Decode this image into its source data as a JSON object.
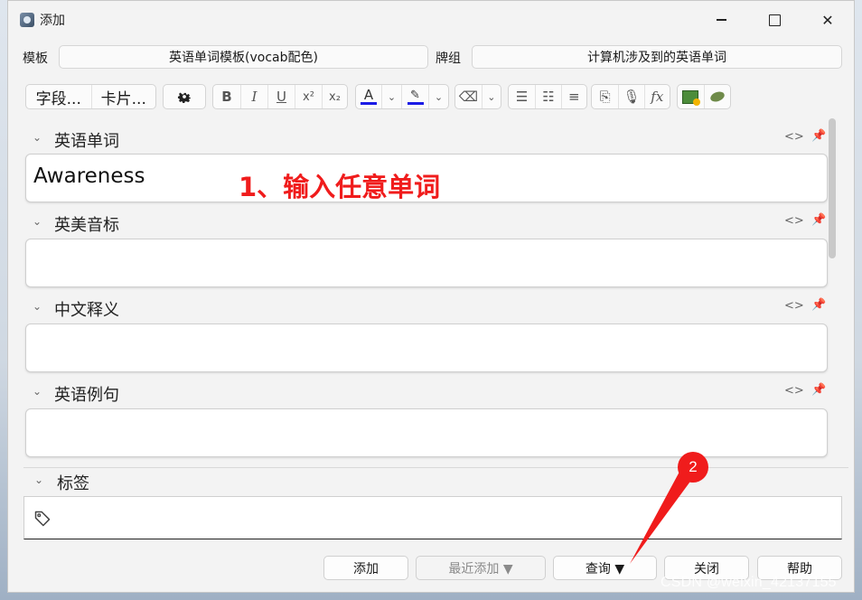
{
  "window": {
    "title": "添加",
    "minimize": "–",
    "maximize": "□",
    "close": "✕"
  },
  "note_type": {
    "label": "模板",
    "value": "英语单词模板(vocab配色)"
  },
  "deck": {
    "label": "牌组",
    "value": "计算机涉及到的英语单词"
  },
  "toolbar": {
    "fields_button": "字段...",
    "cards_button": "卡片...",
    "icons": [
      "gear-icon",
      "bold-icon",
      "italic-icon",
      "underline-icon",
      "superscript-icon",
      "subscript-icon",
      "text-color-icon",
      "highlight-color-icon",
      "eraser-icon",
      "bullet-list-icon",
      "numbered-list-icon",
      "align-icon",
      "attach-icon",
      "record-icon",
      "formula-icon",
      "image-add-icon",
      "ocr-icon"
    ],
    "text_color": "#1b1be6",
    "highlight_color": "#1b1be6"
  },
  "fields": [
    {
      "name": "英语单词",
      "value": "Awareness"
    },
    {
      "name": "英美音标",
      "value": ""
    },
    {
      "name": "中文释义",
      "value": ""
    },
    {
      "name": "英语例句",
      "value": ""
    }
  ],
  "tags": {
    "label": "标签",
    "value": ""
  },
  "buttons": {
    "add": "添加",
    "history": "最近添加 ▼",
    "query": "查询 ▼",
    "close": "关闭",
    "help": "帮助"
  },
  "annotations": {
    "step1": "1、输入任意单词",
    "step2": "2",
    "accent": "#f01c1c"
  },
  "watermark": "CSDN @weixin_42137155"
}
